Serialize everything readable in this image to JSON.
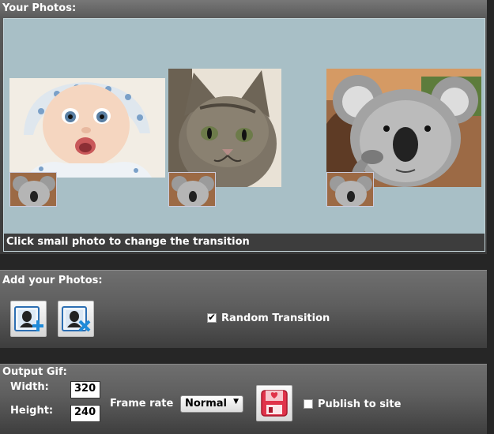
{
  "photos_panel": {
    "title": "Your Photos:",
    "caption": "Click small photo to change the transition",
    "photos": [
      {
        "subject": "baby"
      },
      {
        "subject": "kitten"
      },
      {
        "subject": "koala"
      }
    ]
  },
  "add_panel": {
    "title": "Add your Photos:",
    "add_icon": "add-photo-icon",
    "remove_icon": "remove-photo-icon",
    "random_transition": {
      "label": "Random Transition",
      "checked": true
    }
  },
  "output_panel": {
    "title": "Output Gif:",
    "width_label": "Width:",
    "width_value": "320",
    "height_label": "Height:",
    "height_value": "240",
    "frame_rate_label": "Frame rate",
    "frame_rate_value": "Normal",
    "publish_icon": "save-disk-icon",
    "publish": {
      "label": "Publish to site",
      "checked": false
    }
  },
  "colors": {
    "stage_bg": "#a8bfc6",
    "publish_icon": "#e0334a"
  }
}
